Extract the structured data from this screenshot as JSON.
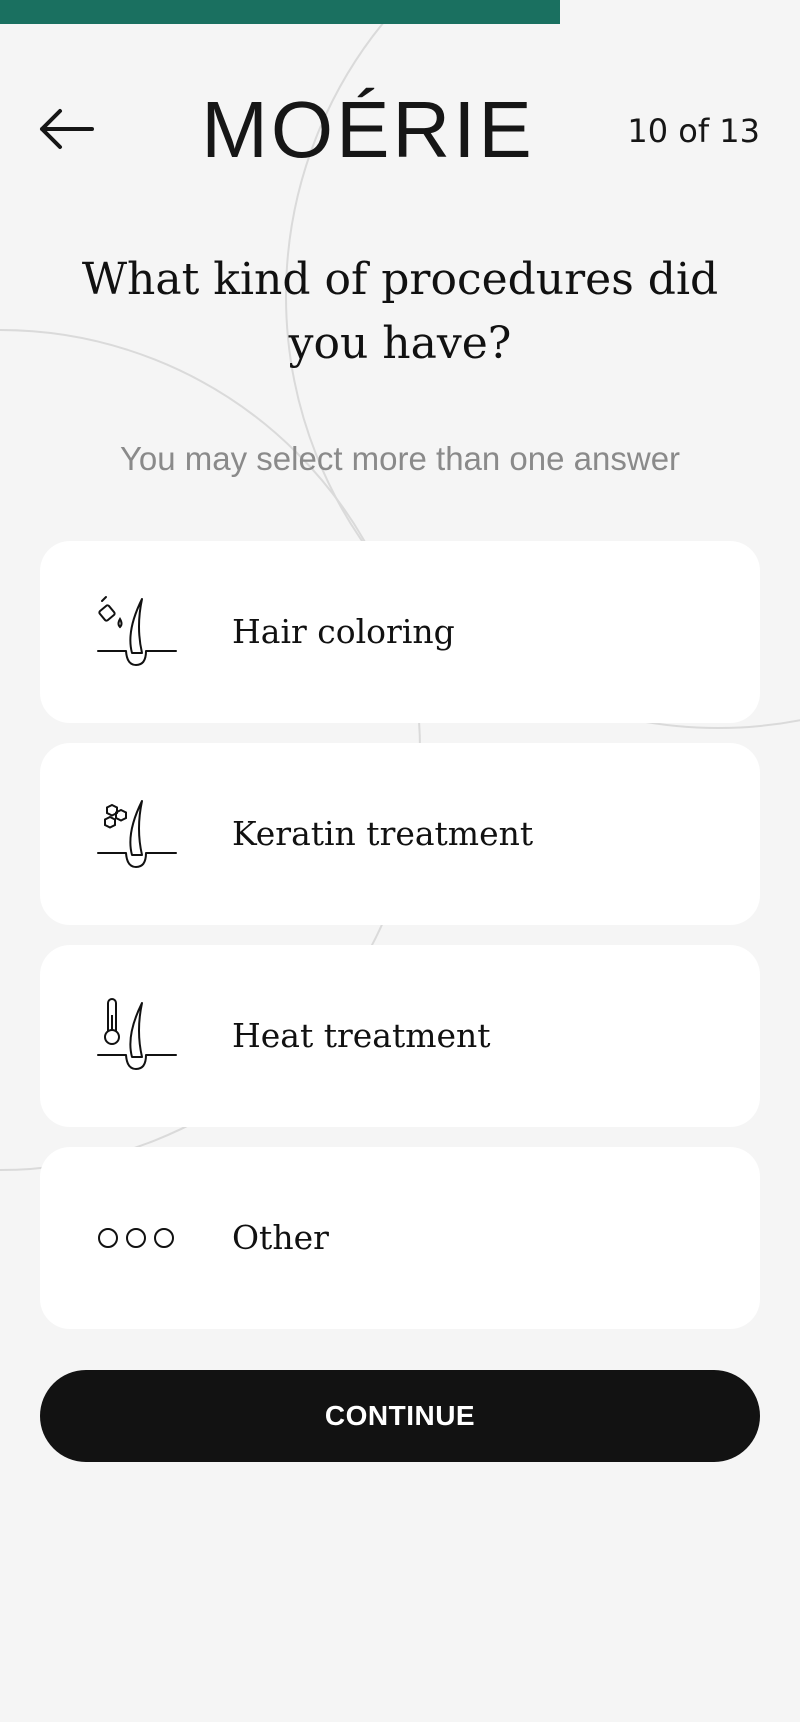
{
  "progress": {
    "fraction": 0.7,
    "color": "#1a7060"
  },
  "header": {
    "back_icon": "arrow-left-icon",
    "logo_text": "MOÉRIE",
    "step_counter": "10 of 13"
  },
  "question": {
    "title": "What kind of procedures did you have?",
    "hint": "You may select more than one answer"
  },
  "options": [
    {
      "label": "Hair coloring",
      "icon": "hair-coloring-icon"
    },
    {
      "label": "Keratin treatment",
      "icon": "keratin-treatment-icon"
    },
    {
      "label": "Heat treatment",
      "icon": "heat-treatment-icon"
    },
    {
      "label": "Other",
      "icon": "three-dots-icon"
    }
  ],
  "continue_label": "CONTINUE",
  "colors": {
    "accent": "#1a7060",
    "background": "#f5f5f5",
    "card": "#ffffff",
    "button": "#121212"
  }
}
